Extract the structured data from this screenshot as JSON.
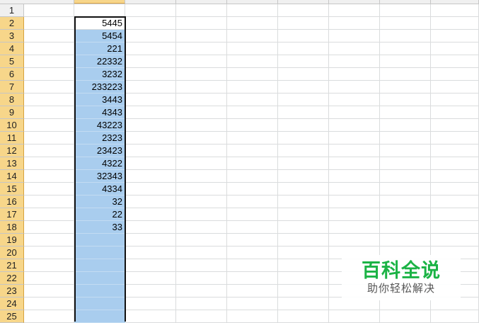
{
  "rows": [
    "1",
    "2",
    "3",
    "4",
    "5",
    "6",
    "7",
    "8",
    "9",
    "10",
    "11",
    "12",
    "13",
    "14",
    "15",
    "16",
    "17",
    "18",
    "19",
    "20",
    "21",
    "22",
    "23",
    "24",
    "25"
  ],
  "column_b_values": [
    "",
    "5445",
    "5454",
    "221",
    "22332",
    "3232",
    "233223",
    "3443",
    "4343",
    "43223",
    "2323",
    "23423",
    "4322",
    "32343",
    "4334",
    "32",
    "22",
    "33",
    "",
    "",
    "",
    "",
    "",
    "",
    ""
  ],
  "watermark": {
    "title": "百科全说",
    "subtitle": "助你轻松解决",
    "color": "#1bb345"
  },
  "colors": {
    "selection_fill": "#a9cdee",
    "active_header": "#f7d68a",
    "grid": "#dadcdd"
  }
}
